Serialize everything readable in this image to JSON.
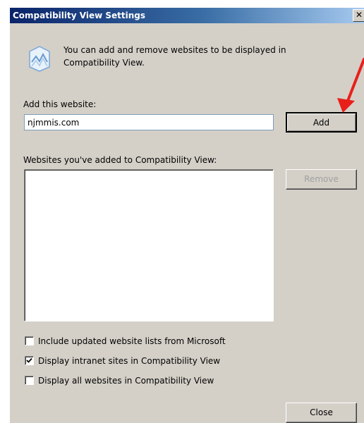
{
  "window": {
    "title": "Compatibility View Settings",
    "close_glyph": "✕"
  },
  "info": {
    "icon": "compatibility-view-icon",
    "text": "You can add and remove websites to be displayed in Compatibility View."
  },
  "add_section": {
    "label": "Add this website:",
    "input_value": "njmmis.com",
    "add_button": "Add"
  },
  "list_section": {
    "label": "Websites you've added to Compatibility View:",
    "items": [],
    "remove_button": "Remove"
  },
  "options": {
    "include_updated": {
      "label": "Include updated website lists from Microsoft",
      "checked": false
    },
    "display_intranet": {
      "label": "Display intranet sites in Compatibility View",
      "checked": true
    },
    "display_all": {
      "label": "Display all websites in Compatibility View",
      "checked": false
    }
  },
  "footer": {
    "close_button": "Close"
  },
  "colors": {
    "dialog_bg": "#d4d0c8",
    "title_bar_start": "#0a246a",
    "title_bar_end": "#a6caf0",
    "annotation_arrow": "#e8201a"
  }
}
